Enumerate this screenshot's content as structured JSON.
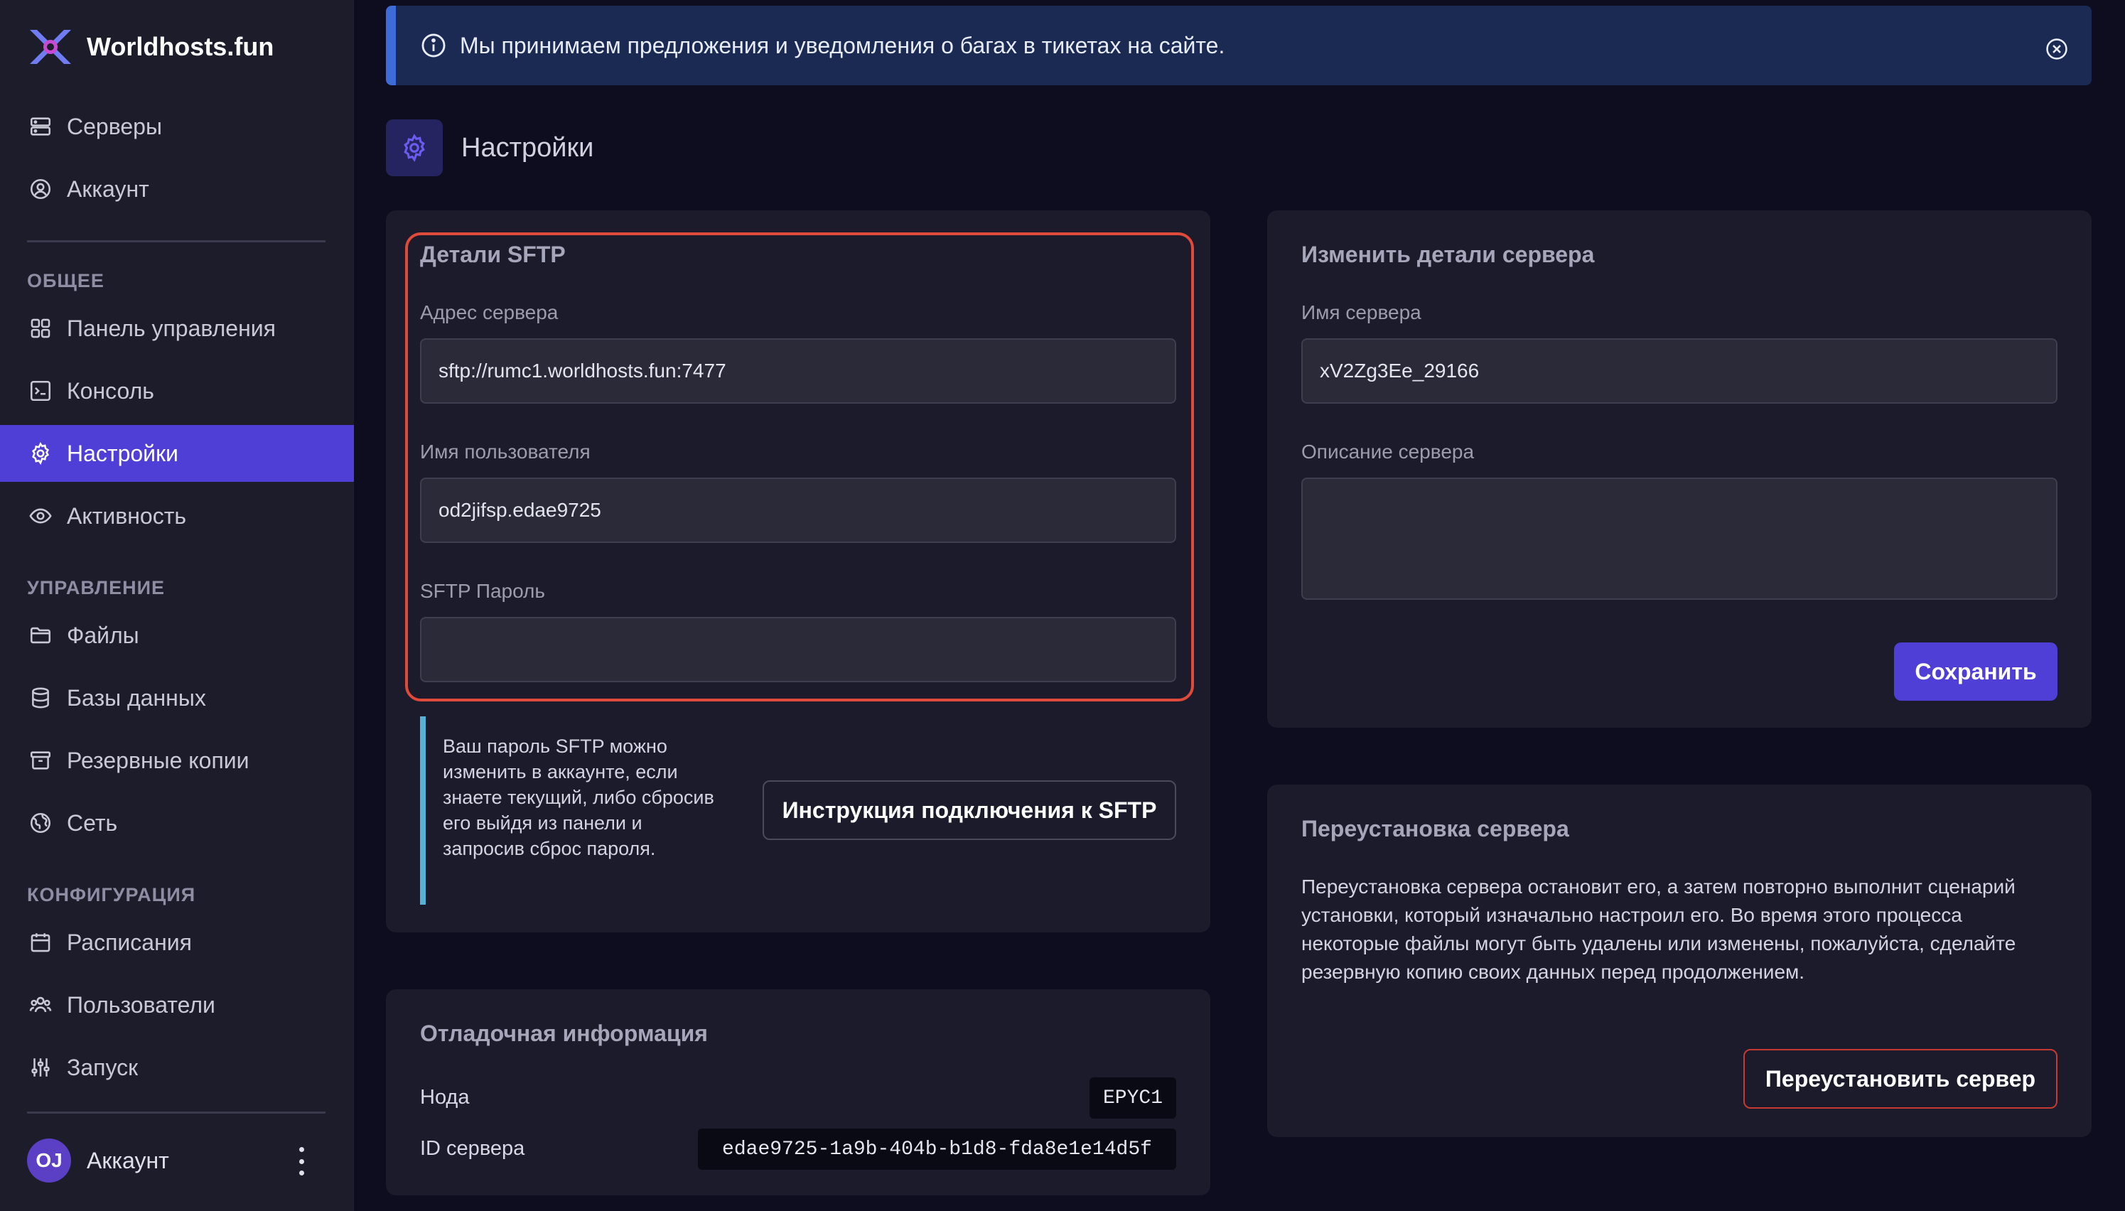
{
  "brand": {
    "name": "Worldhosts.fun"
  },
  "sidebar": {
    "top_items": [
      {
        "label": "Серверы",
        "icon": "server-icon"
      },
      {
        "label": "Аккаунт",
        "icon": "user-circle-icon"
      }
    ],
    "sections": [
      {
        "title": "ОБЩЕЕ"
      },
      {
        "title": "УПРАВЛЕНИЕ"
      },
      {
        "title": "КОНФИГУРАЦИЯ"
      }
    ],
    "general_items": [
      {
        "label": "Панель управления",
        "icon": "grid-icon"
      },
      {
        "label": "Консоль",
        "icon": "terminal-icon"
      },
      {
        "label": "Настройки",
        "icon": "gear-icon",
        "active": true
      },
      {
        "label": "Активность",
        "icon": "eye-icon"
      }
    ],
    "management_items": [
      {
        "label": "Файлы",
        "icon": "folder-icon"
      },
      {
        "label": "Базы данных",
        "icon": "database-icon"
      },
      {
        "label": "Резервные копии",
        "icon": "archive-icon"
      },
      {
        "label": "Сеть",
        "icon": "globe-icon"
      }
    ],
    "config_items": [
      {
        "label": "Расписания",
        "icon": "calendar-icon"
      },
      {
        "label": "Пользователи",
        "icon": "users-icon"
      },
      {
        "label": "Запуск",
        "icon": "sliders-icon"
      }
    ],
    "account": {
      "initials": "OJ",
      "name": "Аккаунт"
    }
  },
  "notice": {
    "text": "Мы принимаем предложения и уведомления о багах в тикетах на сайте."
  },
  "page": {
    "title": "Настройки"
  },
  "sftp": {
    "title": "Детали SFTP",
    "address_label": "Адрес сервера",
    "address_value": "sftp://rumc1.worldhosts.fun:7477",
    "username_label": "Имя пользователя",
    "username_value": "od2jifsp.edae9725",
    "password_label": "SFTP Пароль",
    "password_value": "",
    "hint": "Ваш пароль SFTP можно изменить в аккаунте, если знаете текущий, либо сбросив его выйдя из панели и запросив сброс пароля.",
    "instructions_button": "Инструкция подключения к SFTP"
  },
  "server_details": {
    "title": "Изменить детали сервера",
    "name_label": "Имя сервера",
    "name_value": "xV2Zg3Ee_29166",
    "description_label": "Описание сервера",
    "description_value": "",
    "save_button": "Сохранить"
  },
  "debug": {
    "title": "Отладочная информация",
    "node_label": "Нода",
    "node_value": "EPYC1",
    "server_id_label": "ID сервера",
    "server_id_value": "edae9725-1a9b-404b-b1d8-fda8e1e14d5f"
  },
  "reinstall": {
    "title": "Переустановка сервера",
    "text": "Переустановка сервера остановит его, а затем повторно выполнит сценарий установки, который изначально настроил его. Во время этого процесса некоторые файлы могут быть удалены или изменены, пожалуйста, сделайте резервную копию своих данных перед продолжением.",
    "button": "Переустановить сервер"
  },
  "colors": {
    "accent": "#4f3fd6",
    "danger": "#c73a32",
    "highlight": "#e04a3a",
    "info": "#3f6bd8"
  }
}
